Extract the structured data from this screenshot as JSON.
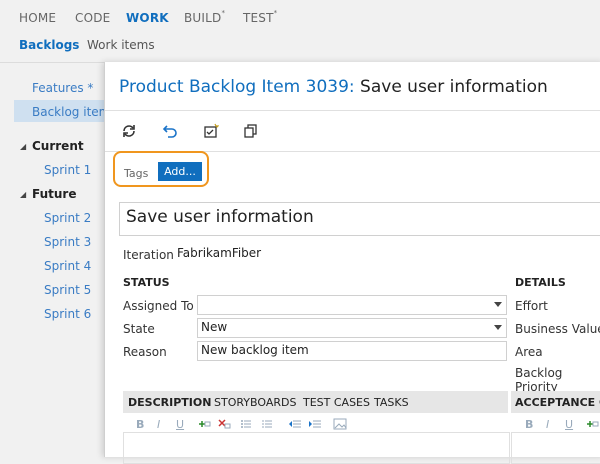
{
  "topnav": {
    "home": "HOME",
    "code": "CODE",
    "work": "WORK",
    "build": "BUILD",
    "build_mark": "*",
    "test": "TEST",
    "test_mark": "*"
  },
  "subnav": {
    "backlogs": "Backlogs",
    "work_items": "Work items"
  },
  "sidebar": {
    "features": "Features *",
    "backlog_items": "Backlog items",
    "current": "Current",
    "sprint1": "Sprint 1",
    "future": "Future",
    "sprint2": "Sprint 2",
    "sprint3": "Sprint 3",
    "sprint4": "Sprint 4",
    "sprint5": "Sprint 5",
    "sprint6": "Sprint 6"
  },
  "dialog": {
    "title_lead": "Product Backlog Item 3039:",
    "title_rest": " Save user information",
    "tags_label": "Tags",
    "add_label": "Add...",
    "title_value": "Save user information",
    "iteration_label": "Iteration",
    "iteration_value": "FabrikamFiber",
    "status_header": "STATUS",
    "assigned_label": "Assigned To",
    "assigned_value": "",
    "state_label": "State",
    "state_value": "New",
    "reason_label": "Reason",
    "reason_value": "New backlog item",
    "details_header": "DETAILS",
    "effort_label": "Effort",
    "business_value_label": "Business Value",
    "area_label": "Area",
    "backlog_priority_label": "Backlog Priority",
    "tabs": {
      "description": "DESCRIPTION",
      "storyboards": "STORYBOARDS",
      "test_cases": "TEST CASES",
      "tasks": "TASKS"
    },
    "acceptance_tab": "ACCEPTANCE CR",
    "fmt": {
      "bold": "B",
      "italic": "I",
      "underline": "U"
    }
  }
}
